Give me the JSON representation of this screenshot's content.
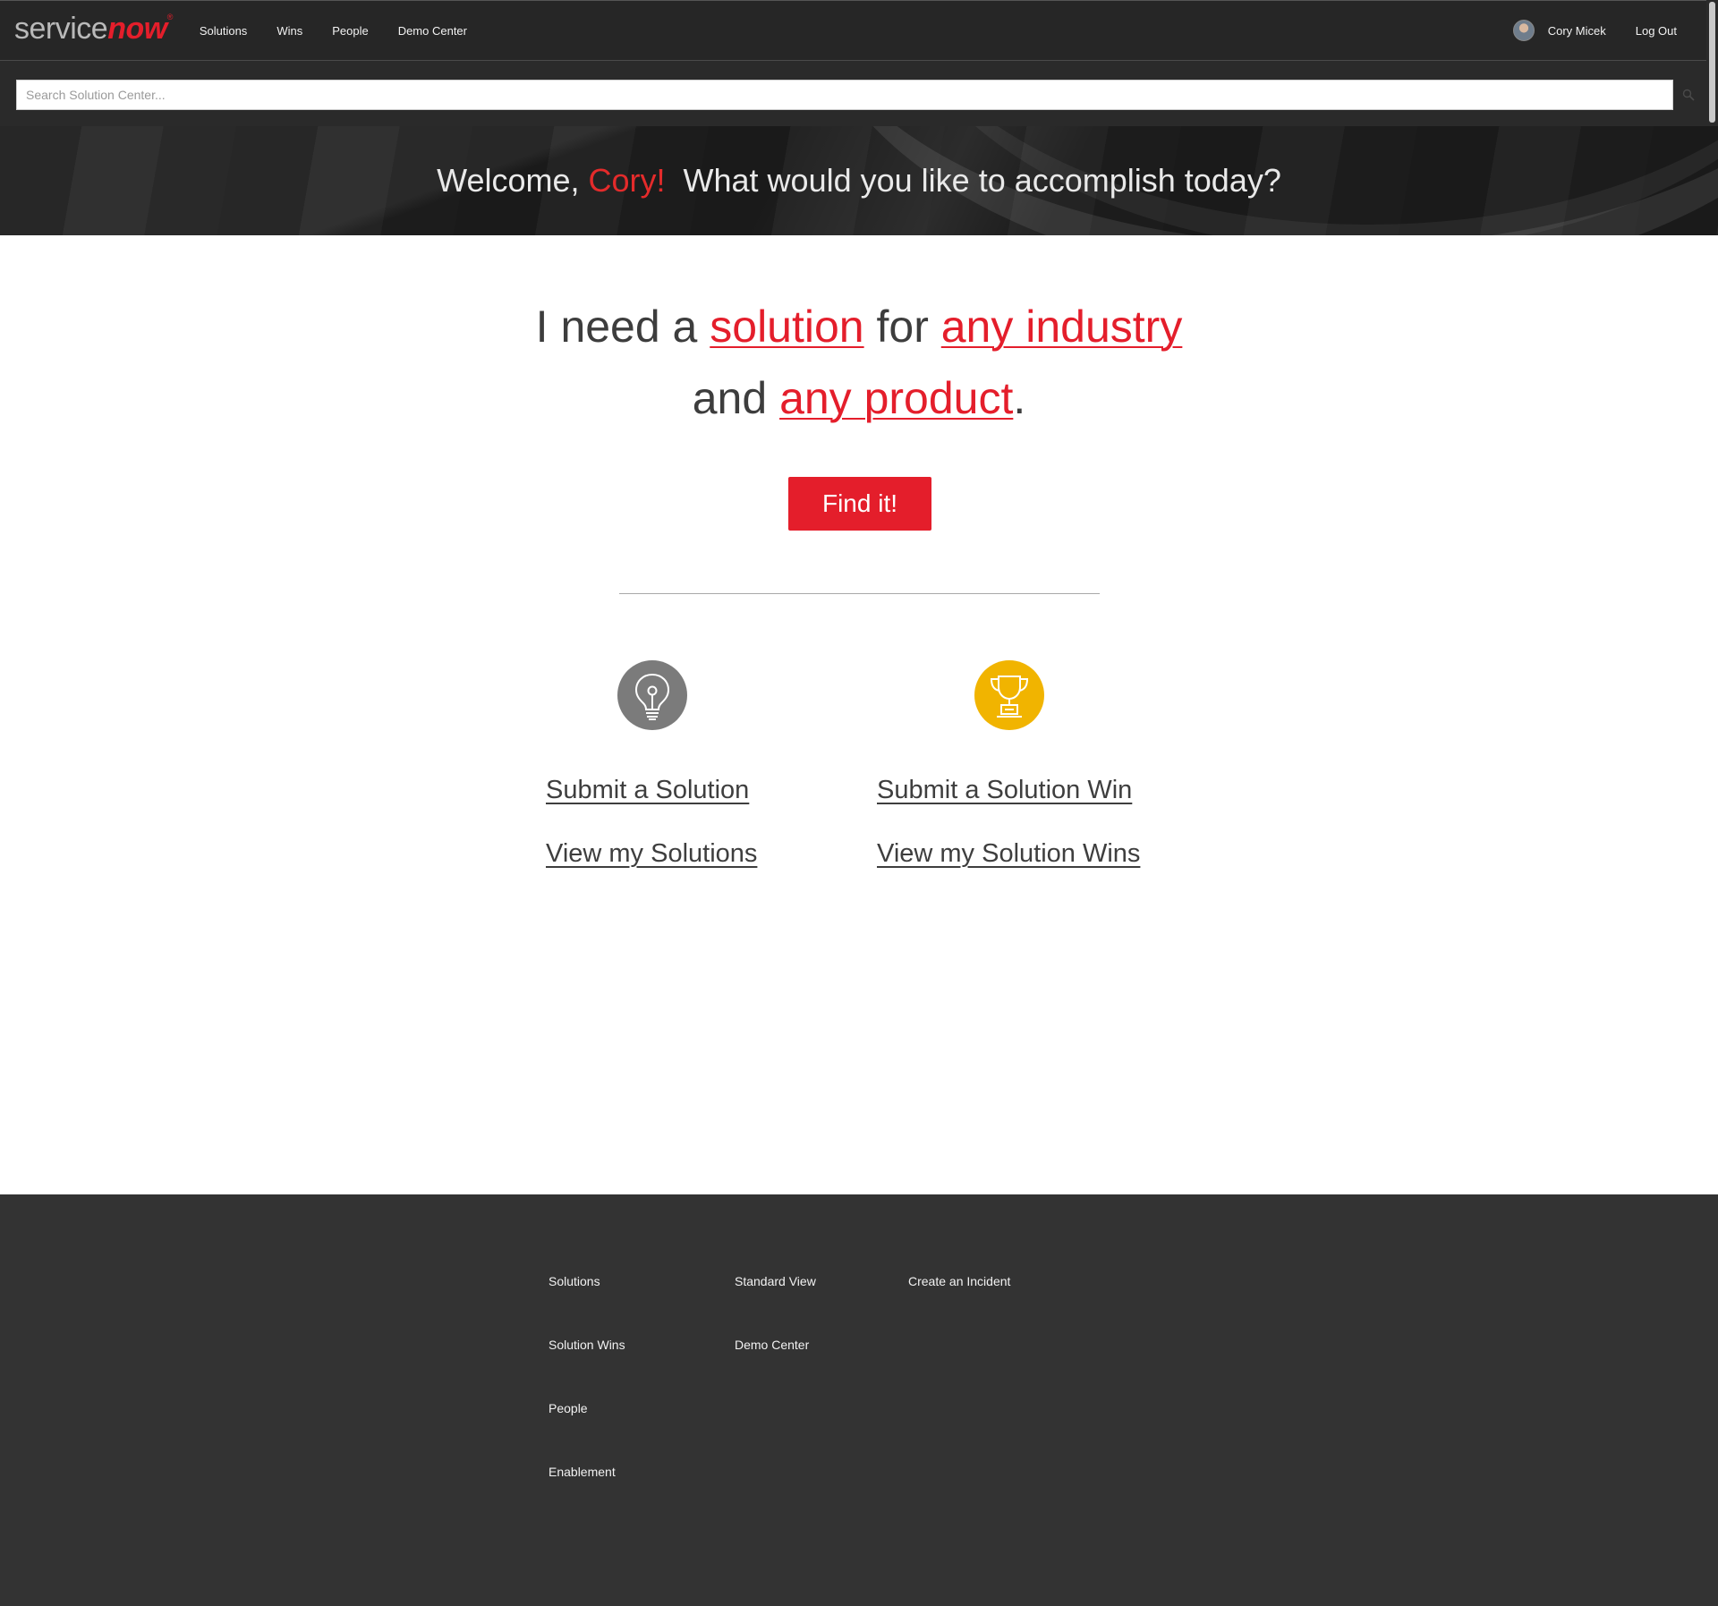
{
  "brand": {
    "logo_part1": "service",
    "logo_part2": "now",
    "logo_mark": "®",
    "accent_color": "#e41e2b"
  },
  "nav": {
    "items": [
      {
        "label": "Solutions"
      },
      {
        "label": "Wins"
      },
      {
        "label": "People"
      },
      {
        "label": "Demo Center"
      }
    ],
    "user_name": "Cory Micek",
    "logout_label": "Log Out"
  },
  "search": {
    "placeholder": "Search Solution Center...",
    "value": "",
    "icon": "search-icon"
  },
  "hero": {
    "welcome": "Welcome, ",
    "name": "Cory!",
    "question": "  What would you like to accomplish today?"
  },
  "finder": {
    "line1_prefix": "I need a ",
    "solution_link": "solution",
    "line1_mid": " for ",
    "industry_link": "any industry",
    "line2_prefix": "and ",
    "product_link": "any product",
    "line2_suffix": ".",
    "button_label": "Find it!"
  },
  "actions": {
    "solutions_icon": "lightbulb-icon",
    "wins_icon": "trophy-icon",
    "submit_solution": "Submit a Solution",
    "view_solutions": "View my Solutions",
    "submit_win": "Submit a Solution Win",
    "view_wins": "View my Solution Wins",
    "solutions_icon_color": "#7b7b7b",
    "wins_icon_color": "#f1b400"
  },
  "footer": {
    "col1": [
      "Solutions",
      "Solution Wins",
      "People",
      "Enablement"
    ],
    "col2": [
      "Standard View",
      "Demo Center"
    ],
    "col3": [
      "Create an Incident"
    ],
    "background": "#333333"
  }
}
